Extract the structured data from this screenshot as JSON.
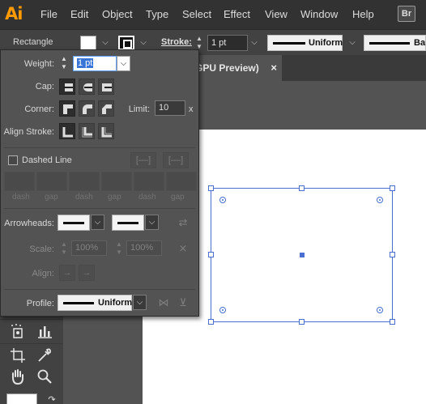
{
  "app": {
    "logo": "Ai",
    "bridge_badge": "Br"
  },
  "menu": [
    "File",
    "Edit",
    "Object",
    "Type",
    "Select",
    "Effect",
    "View",
    "Window",
    "Help"
  ],
  "control_bar": {
    "object_type": "Rectangle",
    "stroke_label": "Stroke:",
    "stroke_weight": "1 pt",
    "profile_1": "Uniform",
    "profile_2": "Bas"
  },
  "document_tab": {
    "title": "GPU Preview)",
    "close": "×"
  },
  "stroke_panel": {
    "weight_label": "Weight:",
    "weight_value": "1 pt",
    "cap_label": "Cap:",
    "corner_label": "Corner:",
    "limit_label": "Limit:",
    "limit_value": "10",
    "limit_unit": "x",
    "align_stroke_label": "Align Stroke:",
    "dashed_line_label": "Dashed Line",
    "dashed_line_checked": false,
    "dash_gap_labels": [
      "dash",
      "gap",
      "dash",
      "gap",
      "dash",
      "gap"
    ],
    "arrowheads_label": "Arrowheads:",
    "scale_label": "Scale:",
    "scale_values": [
      "100%",
      "100%"
    ],
    "align_label": "Align:",
    "profile_label": "Profile:",
    "profile_value": "Uniform"
  },
  "colors": {
    "menubar_bg": "#323232",
    "panel_bg": "#535353",
    "selection_blue": "#4a6fd0",
    "logo_orange": "#ff9a00"
  },
  "icons": {
    "tools": [
      "symbol-sprayer-icon",
      "column-graph-icon",
      "artboard-icon",
      "eyedropper-icon",
      "hand-icon",
      "zoom-icon",
      "swap-arrow-icon"
    ],
    "cap": [
      "butt-cap-icon",
      "round-cap-icon",
      "projecting-cap-icon"
    ],
    "corner": [
      "miter-join-icon",
      "round-join-icon",
      "bevel-join-icon"
    ],
    "align": [
      "align-center-icon",
      "align-inside-icon",
      "align-outside-icon"
    ]
  }
}
